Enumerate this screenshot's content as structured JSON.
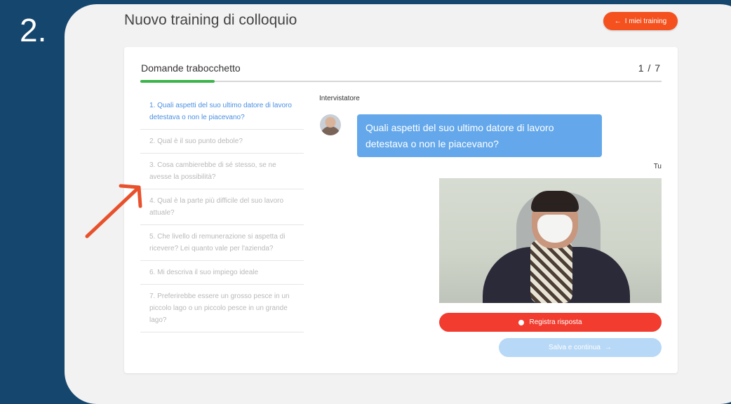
{
  "step_number": "2.",
  "header": {
    "title": "Nuovo training di colloquio",
    "my_trainings_label": "I miei training",
    "my_trainings_icon": "arrow-left-icon"
  },
  "section": {
    "title": "Domande trabocchetto",
    "counter": "1 / 7",
    "progress_fraction": 0.143
  },
  "questions": [
    "1. Quali aspetti del suo ultimo datore di lavoro detestava o non le piacevano?",
    "2. Qual è il suo punto debole?",
    "3. Cosa cambierebbe di sé stesso, se ne avesse la possibilità?",
    "4. Qual è la parte più difficile del suo lavoro attuale?",
    "5. Che livello di remunerazione si aspetta di ricevere? Lei quanto vale per l'azienda?",
    "6. Mi descriva il suo impiego ideale",
    "7. Preferirebbe essere un grosso pesce in un piccolo lago o un piccolo pesce in un grande lago?"
  ],
  "chat": {
    "interviewer_label": "Intervistatore",
    "interviewer_message": "Quali aspetti del suo ultimo datore di lavoro detestava o non le piacevano?",
    "user_label": "Tu"
  },
  "buttons": {
    "record_label": "Registra risposta",
    "save_label": "Salva e continua"
  },
  "colors": {
    "background": "#15466e",
    "accent_orange": "#f4511e",
    "record_red": "#f13c2f",
    "bubble_blue": "#64a8eb",
    "progress_green": "#3bb54a"
  }
}
